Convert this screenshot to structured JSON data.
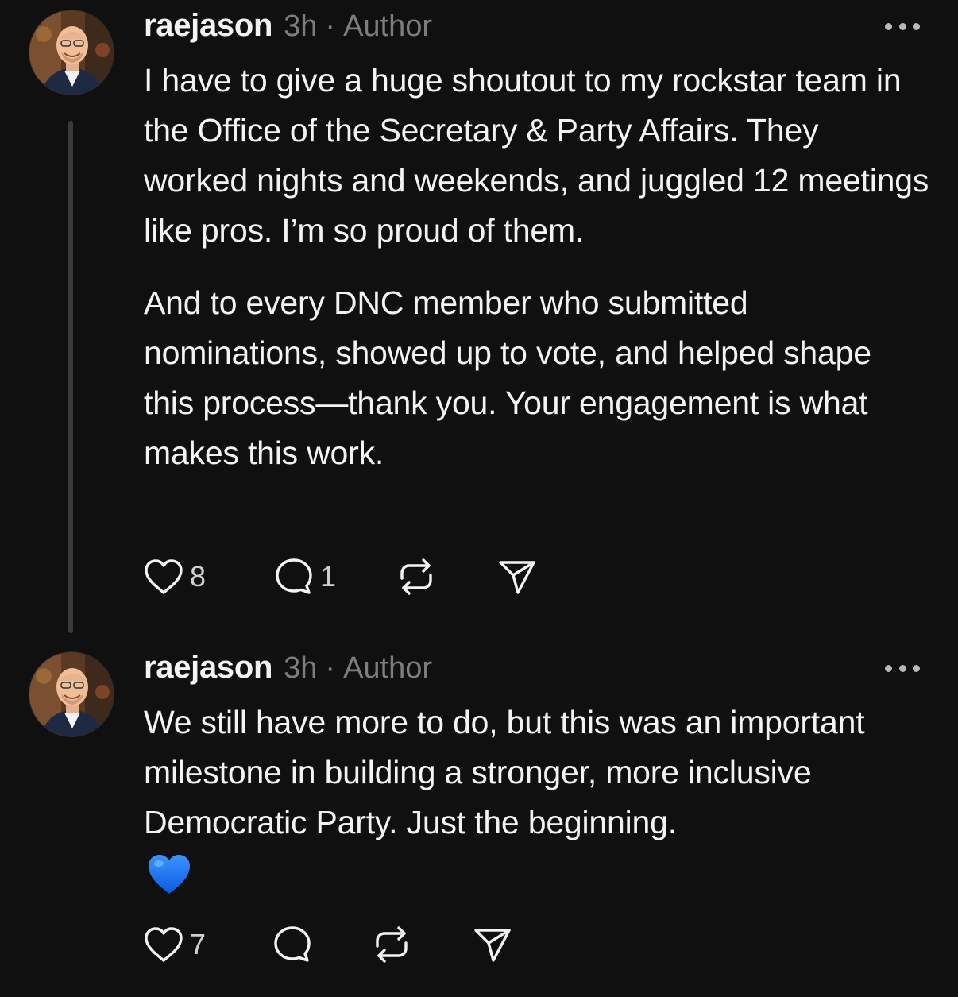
{
  "posts": [
    {
      "username": "raejason",
      "time": "3h",
      "separator": "·",
      "role": "Author",
      "paragraphs": [
        "I have to give a huge shoutout to my rockstar team in the Office of the Secretary & Party Affairs. They worked nights and weekends, and juggled 12 meetings like pros. I’m so proud of them.",
        "And to every DNC member who submitted nominations, showed up to vote, and helped shape this process—thank you. Your engagement is what makes this work."
      ],
      "likes": "8",
      "replies": "1"
    },
    {
      "username": "raejason",
      "time": "3h",
      "separator": "·",
      "role": "Author",
      "paragraphs": [
        "We still have more to do, but this was an important milestone in building a stronger, more inclusive Democratic Party. Just the beginning."
      ],
      "emoji": "blue-heart-emoji",
      "likes": "7",
      "replies": ""
    }
  ],
  "icons": {
    "like": "heart-icon",
    "reply": "comment-icon",
    "repost": "repost-icon",
    "share": "send-icon",
    "more": "more-icon"
  },
  "colors": {
    "background": "#101010",
    "text": "#f3f3f3",
    "muted": "#7d7d7d",
    "thread_line": "#3a3a3a",
    "emoji_blue": "#1f7bff"
  }
}
